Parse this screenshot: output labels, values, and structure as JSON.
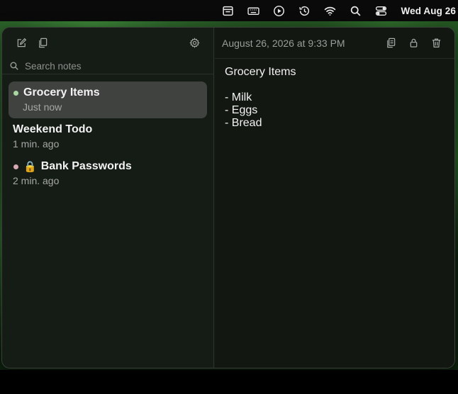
{
  "menubar": {
    "clock": "Wed Aug 26",
    "icons": [
      "notes-menu-icon",
      "keyboard-icon",
      "play-icon",
      "history-icon",
      "wifi-icon",
      "search-icon",
      "control-center-icon"
    ]
  },
  "sidebar": {
    "search_placeholder": "Search notes",
    "notes": [
      {
        "title": "Grocery Items",
        "subtitle": "Just now",
        "dot_color": "#a8d8a0",
        "selected": true,
        "locked": false
      },
      {
        "title": "Weekend Todo",
        "subtitle": "1 min. ago",
        "dot_color": "",
        "selected": false,
        "locked": false
      },
      {
        "title": "Bank Passwords",
        "subtitle": "2 min. ago",
        "dot_color": "#d6a8b4",
        "selected": false,
        "locked": true
      }
    ]
  },
  "editor": {
    "date": "August 26, 2026 at 9:33 PM",
    "content": "Grocery Items\n\n- Milk\n- Eggs\n- Bread"
  }
}
